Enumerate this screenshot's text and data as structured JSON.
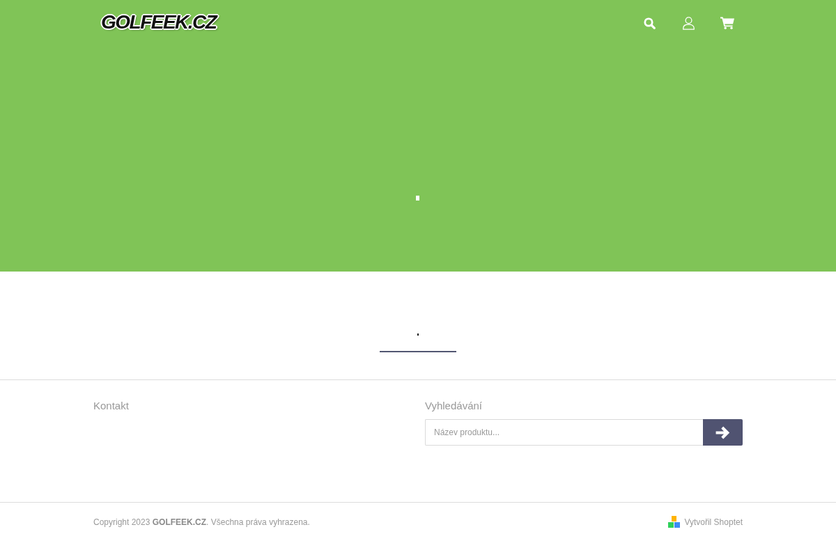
{
  "header": {
    "logo": "GOLFEEK.CZ"
  },
  "footer": {
    "columns": [
      {
        "kind": "contact",
        "title": "Kontakt"
      },
      {
        "kind": "search",
        "title": "Vyhledávání",
        "search": {
          "placeholder": "Název produktu..."
        }
      }
    ]
  },
  "bottom_bar": {
    "copyright": "Copyright 2023 **GOLFEEK.CZ**. Všechna práva vyhrazena.",
    "credit": "Vytvořil Shoptet"
  }
}
